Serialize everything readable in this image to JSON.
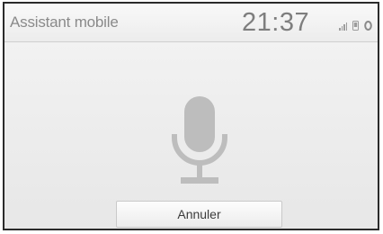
{
  "header": {
    "app_title": "Assistant mobile",
    "clock": "21:37"
  },
  "status_icons": [
    "signal-strength-icon",
    "phone-icon",
    "battery-icon"
  ],
  "main": {
    "icon": "microphone-icon",
    "cancel_button_label": "Annuler"
  },
  "colors": {
    "background": "#eeeeee",
    "text": "#8a8a8a",
    "icon": "#bdbdbd",
    "border": "#2b2b2b"
  }
}
